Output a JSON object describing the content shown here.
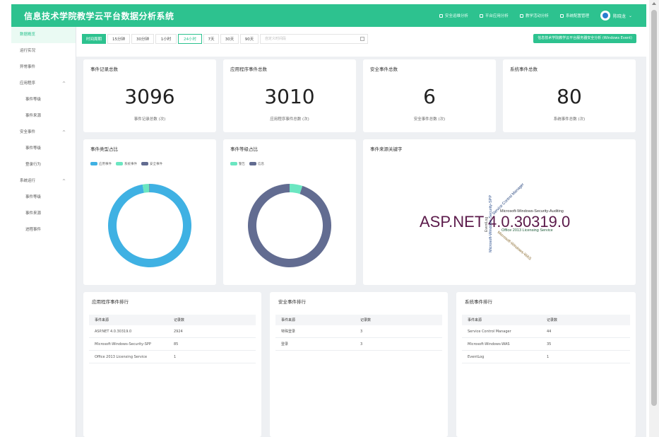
{
  "app": {
    "title": "信息技术学院教学云平台数据分析系统"
  },
  "nav": [
    {
      "label": "安全运维分析",
      "icon": "monitor-icon"
    },
    {
      "label": "平台应用分析",
      "icon": "grid-icon"
    },
    {
      "label": "教学活动分析",
      "icon": "video-icon"
    },
    {
      "label": "系统配置管理",
      "icon": "settings-icon"
    }
  ],
  "user": {
    "name": "陈晓龙"
  },
  "sidebar": {
    "items": [
      {
        "label": "数据概览",
        "active": true
      },
      {
        "label": "运行实况"
      },
      {
        "label": "异常事件"
      },
      {
        "label": "应用程序",
        "group": true
      },
      {
        "label": "事件等级",
        "sub": true
      },
      {
        "label": "事件来源",
        "sub": true
      },
      {
        "label": "安全事件",
        "group": true
      },
      {
        "label": "事件等级",
        "sub": true
      },
      {
        "label": "登录行为",
        "sub": true
      },
      {
        "label": "系统运行",
        "group": true
      },
      {
        "label": "事件等级",
        "sub": true
      },
      {
        "label": "事件来源",
        "sub": true
      },
      {
        "label": "进程事件",
        "sub": true
      }
    ]
  },
  "filters": {
    "buttons": [
      "时间周期",
      "15分钟",
      "30分钟",
      "1小时",
      "24小时",
      "7天",
      "30天",
      "90天"
    ],
    "selected": "24小时",
    "date_placeholder": "自定义时间段",
    "security_button": "信息技术学院教学云平台服务器安全分析 (Windows Event)"
  },
  "stats": [
    {
      "title": "事件记录总数",
      "value": "3096",
      "sub": "事件记录总数 (次)"
    },
    {
      "title": "应用程序事件总数",
      "value": "3010",
      "sub": "应用程序事件总数 (次)"
    },
    {
      "title": "安全事件总数",
      "value": "6",
      "sub": "安全事件总数 (次)"
    },
    {
      "title": "系统事件总数",
      "value": "80",
      "sub": "系统事件总数 (次)"
    }
  ],
  "charts": {
    "type_title": "事件类型占比",
    "level_title": "事件等级占比",
    "source_title": "事件来源关键字"
  },
  "chart_data": [
    {
      "type": "pie",
      "title": "事件类型占比",
      "categories": [
        "应用事件",
        "系统事件",
        "安全事件"
      ],
      "values": [
        3010,
        80,
        6
      ],
      "colors": [
        "#3fb1e3",
        "#6be6c1",
        "#626c91"
      ]
    },
    {
      "type": "pie",
      "title": "事件等级占比",
      "categories": [
        "警告",
        "信息"
      ],
      "values": [
        5,
        95
      ],
      "colors": [
        "#6be6c1",
        "#626c91"
      ]
    }
  ],
  "wordcloud": [
    {
      "text": "ASP.NET 4.0.30319.0",
      "color": "#5b1a4a"
    },
    {
      "text": "Microsoft-Windows-Security-Auditing",
      "color": "#333333"
    },
    {
      "text": "Office 2013 Licensing Service",
      "color": "#1f5c3a"
    },
    {
      "text": "Service Control Manager",
      "color": "#1f3f7a"
    },
    {
      "text": "Microsoft-Windows-Security-SPP",
      "color": "#2b4e8c"
    },
    {
      "text": "Microsoft-Windows-WAS",
      "color": "#8a6a2e"
    },
    {
      "text": "EventLog",
      "color": "#555555"
    }
  ],
  "tables": {
    "app": {
      "title": "应用程序事件排行",
      "headers": [
        "事件来源",
        "记录数"
      ],
      "rows": [
        [
          "ASP.NET 4.0.30319.0",
          "2924"
        ],
        [
          "Microsoft-Windows-Security-SPP",
          "85"
        ],
        [
          "Office 2013 Licensing Service",
          "1"
        ]
      ]
    },
    "security": {
      "title": "安全事件排行",
      "headers": [
        "事件来源",
        "记录数"
      ],
      "rows": [
        [
          "特殊登录",
          "3"
        ],
        [
          "登录",
          "3"
        ]
      ]
    },
    "system": {
      "title": "系统事件排行",
      "headers": [
        "事件来源",
        "记录数"
      ],
      "rows": [
        [
          "Service Control Manager",
          "44"
        ],
        [
          "Microsoft-Windows-WAS",
          "35"
        ],
        [
          "EventLog",
          "1"
        ]
      ]
    }
  }
}
